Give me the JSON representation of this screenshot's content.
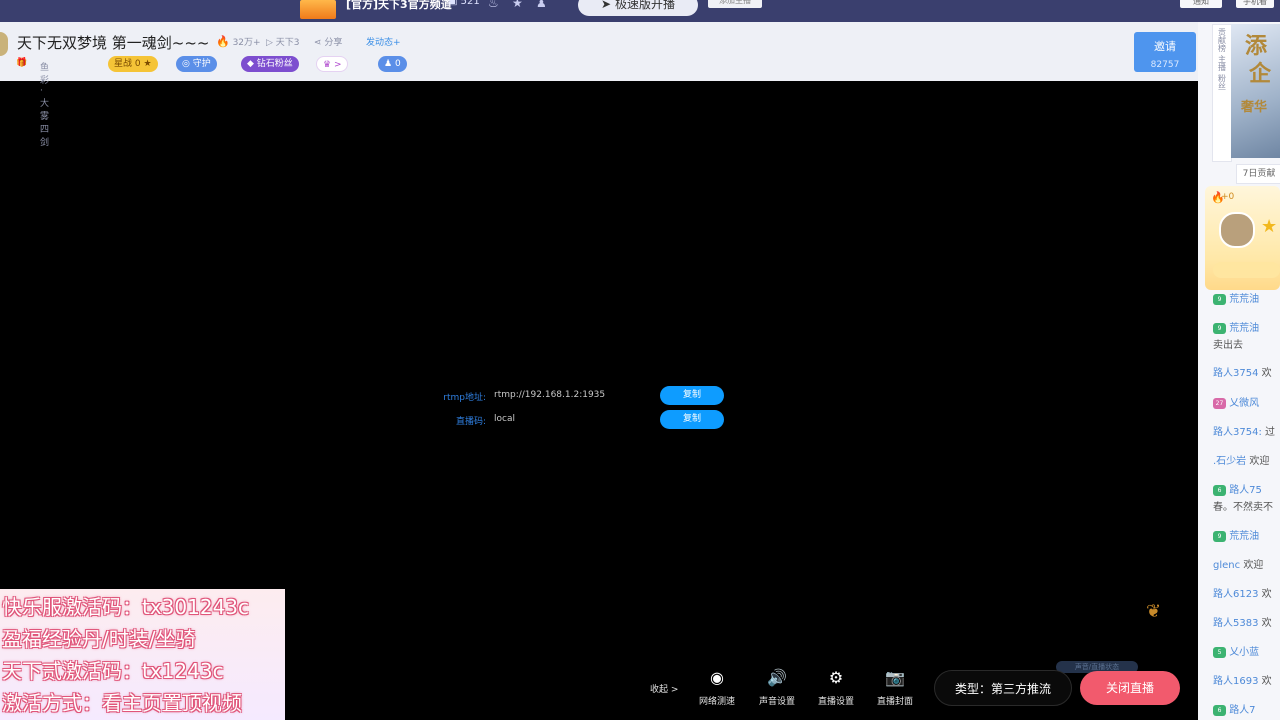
{
  "topbar": {
    "room_name": "[官方]天下3官方频道",
    "viewers": "521",
    "fast_open_label": "极速版开播",
    "btn_small": "添加主播",
    "notice_label": "通知",
    "phone_label": "手机看"
  },
  "header": {
    "title": "天下无双梦境  第一魂剑~~~",
    "hot_count": "32万+",
    "game_label": "天下3",
    "share_label": "分享",
    "dynamic_label": "发动态+",
    "subtitle": "鱼彩·大雾四剑",
    "fans_badge": "星战",
    "fans_count": "0",
    "guard_label": "守护",
    "diamond_label": "钻石粉丝",
    "noble_label": ">",
    "people_count": "0",
    "invite_label": "邀请",
    "invite_count": "82757"
  },
  "stream": {
    "rtmp_label": "rtmp地址:",
    "rtmp_value": "rtmp://192.168.1.2:1935",
    "code_label": "直播码:",
    "code_value": "local",
    "copy_label": "复制"
  },
  "promo": {
    "line1": "快乐服激活码：tx301243c",
    "line2": "盈福经验丹/时装/坐骑",
    "line3": "天下贰激活码：tx1243c",
    "line4": "激活方式：看主页置顶视频"
  },
  "controls": {
    "collapse_label": "收起 >",
    "items": [
      {
        "label": "网络测速",
        "icon": "speed-icon"
      },
      {
        "label": "声音设置",
        "icon": "speaker-icon"
      },
      {
        "label": "直播设置",
        "icon": "settings-icon"
      },
      {
        "label": "直播封面",
        "icon": "camera-icon"
      }
    ],
    "type_label": "类型：第三方推流",
    "close_label": "关闭直播",
    "pill_dark": "声音/直播状态"
  },
  "sidebar": {
    "vtabs": [
      "贡献榜",
      "主播",
      "粉丝"
    ],
    "banner_text": [
      "添",
      "企",
      "奢华"
    ],
    "rank_label": "7日贡献",
    "gold_plus": "+0",
    "chat": [
      {
        "badge": "9",
        "name": "荒荒油",
        "text": "",
        "pink": false
      },
      {
        "badge": "9",
        "name": "荒荒油",
        "text": "",
        "pink": false
      },
      {
        "badge": "",
        "name": "",
        "text": "卖出去",
        "pink": false
      },
      {
        "badge": "",
        "name": "路人3754",
        "text": "欢",
        "pink": false
      },
      {
        "badge": "27",
        "name": "乂微风",
        "text": "",
        "pink": true
      },
      {
        "badge": "",
        "name": "路人3754:",
        "text": "过",
        "pink": false
      },
      {
        "badge": "",
        "name": ".石少岩",
        "text": "欢迎",
        "pink": false
      },
      {
        "badge": "6",
        "name": "路人75",
        "text": "",
        "pink": false
      },
      {
        "badge": "",
        "name": "",
        "text": "春。不然卖不",
        "pink": false
      },
      {
        "badge": "9",
        "name": "荒荒油",
        "text": "",
        "pink": false
      },
      {
        "badge": "",
        "name": "glenc",
        "text": "欢迎",
        "pink": false
      },
      {
        "badge": "",
        "name": "路人6123",
        "text": "欢",
        "pink": false
      },
      {
        "badge": "",
        "name": "路人5383",
        "text": "欢",
        "pink": false
      },
      {
        "badge": "5",
        "name": "乂小蓝",
        "text": "",
        "pink": false
      },
      {
        "badge": "",
        "name": "路人1693",
        "text": "欢",
        "pink": false
      },
      {
        "badge": "6",
        "name": "路人7",
        "text": "",
        "pink": false
      }
    ]
  }
}
